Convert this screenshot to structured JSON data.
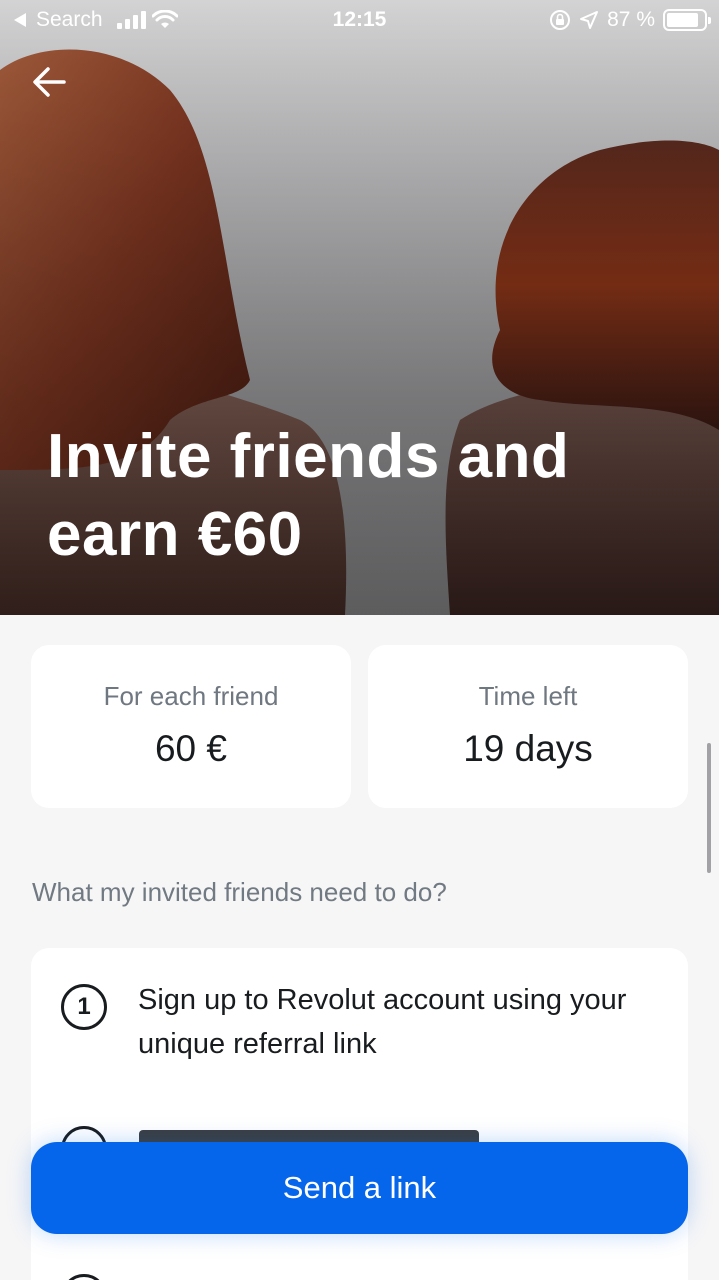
{
  "status_bar": {
    "back_label": "Search",
    "time": "12:15",
    "battery": "87 %",
    "battery_level": 0.87
  },
  "hero": {
    "title_line1": "Invite friends and",
    "title_line2": "earn €60"
  },
  "stats": [
    {
      "label": "For each friend",
      "value": "60 €"
    },
    {
      "label": "Time left",
      "value": "19 days"
    }
  ],
  "requirements_question": "What my invited friends need to do?",
  "steps": [
    {
      "number": "1",
      "text": "Sign up to Revolut account using your unique referral link"
    }
  ],
  "primary_button": {
    "label": "Send a link"
  },
  "colors": {
    "accent": "#0666eb",
    "background": "#f6f6f7",
    "card": "#ffffff",
    "text": "#191c1f",
    "muted": "#717a82"
  }
}
